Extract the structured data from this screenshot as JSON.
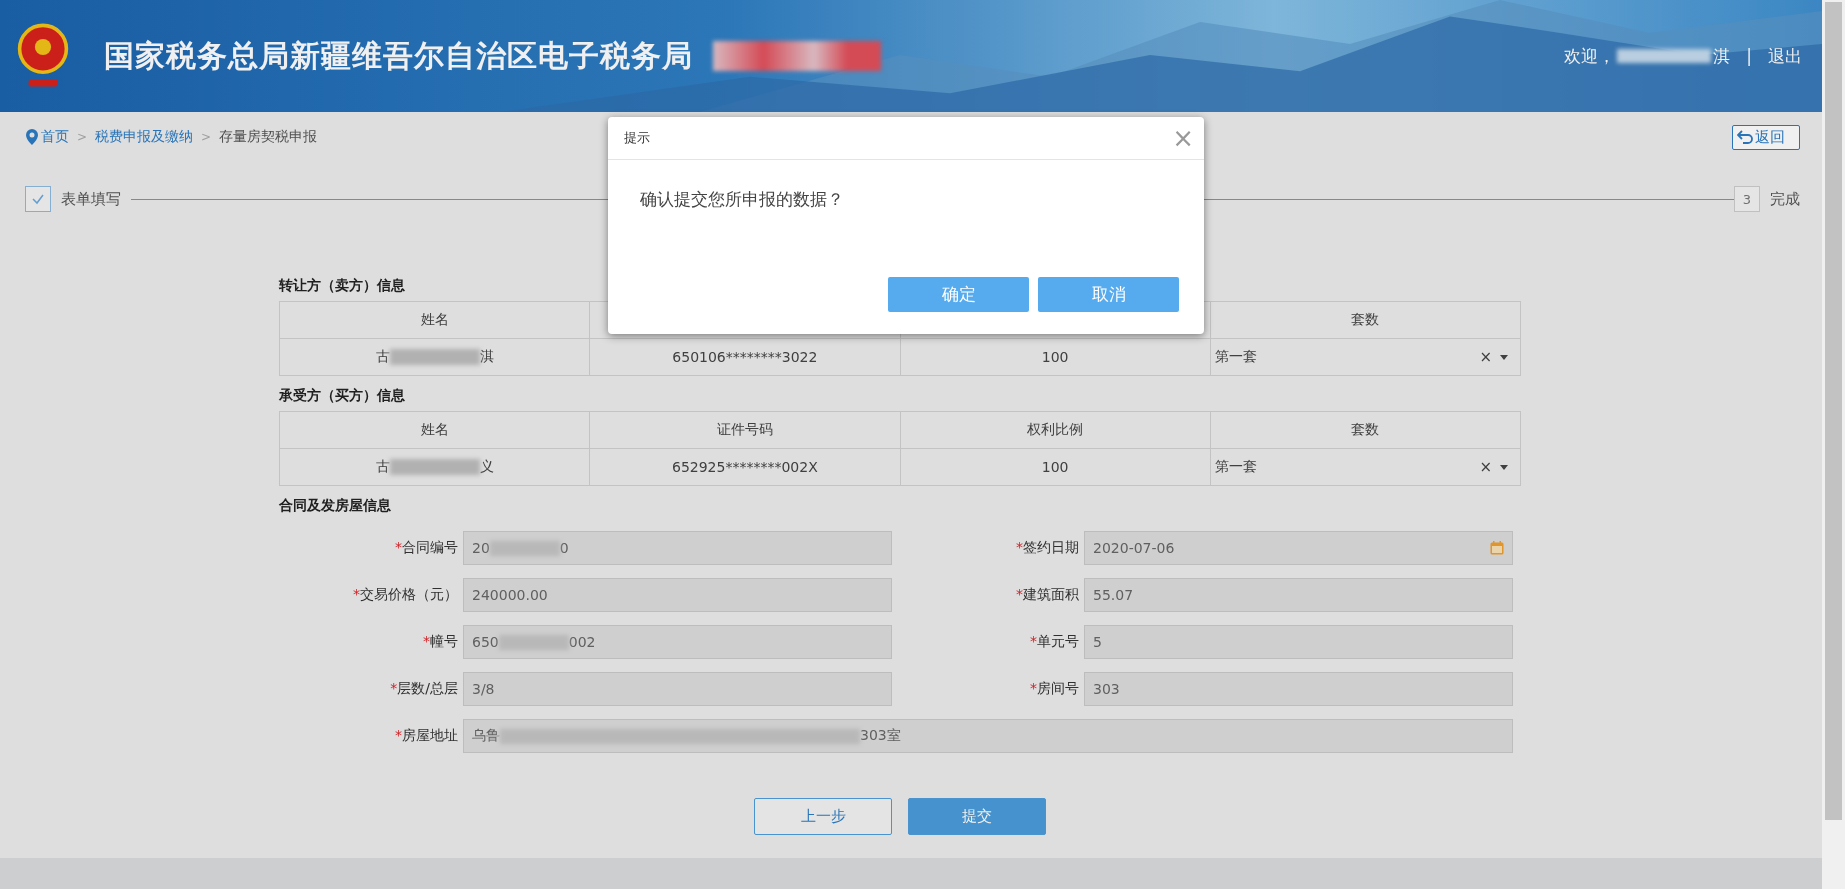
{
  "header": {
    "title": "国家税务总局新疆维吾尔自治区电子税务局",
    "welcome": "欢迎，",
    "user_tail": "淇",
    "separator": "|",
    "logout": "退出"
  },
  "breadcrumb": [
    {
      "label": "首页",
      "kind": "link"
    },
    {
      "label": "税费申报及缴纳",
      "kind": "link"
    },
    {
      "label": "存量房契税申报",
      "kind": "current"
    }
  ],
  "breadcrumb_separator": ">",
  "back_button": "返回",
  "steps": [
    {
      "label": "表单填写",
      "done": true
    },
    {
      "label": "完成",
      "marker": "3",
      "done": false
    }
  ],
  "seller": {
    "title": "转让方（卖方）信息",
    "columns": [
      "姓名",
      "",
      "",
      "套数"
    ],
    "row": {
      "name_start": "古",
      "name_end": "淇",
      "id": "650106********3022",
      "share": "100",
      "set": "第一套"
    }
  },
  "buyer": {
    "title": "承受方（买方）信息",
    "columns": [
      "姓名",
      "证件号码",
      "权利比例",
      "套数"
    ],
    "row": {
      "name_start": "古",
      "name_end": "义",
      "id": "652925********002X",
      "share": "100",
      "set": "第一套"
    }
  },
  "select_clear": "×",
  "contract": {
    "title": "合同及发房屋信息",
    "fields": [
      {
        "label": "合同编号",
        "start": "20",
        "end": "0",
        "kind": "redacted"
      },
      {
        "label": "签约日期",
        "value": "2020-07-06",
        "kind": "date"
      },
      {
        "label": "交易价格（元）",
        "value": "240000.00",
        "kind": "text"
      },
      {
        "label": "建筑面积",
        "value": "55.07",
        "kind": "text"
      },
      {
        "label": "幢号",
        "start": "650",
        "end": "002",
        "kind": "redacted"
      },
      {
        "label": "单元号",
        "value": "5",
        "kind": "text"
      },
      {
        "label": "层数/总层",
        "value": "3/8",
        "kind": "text"
      },
      {
        "label": "房间号",
        "value": "303",
        "kind": "text"
      },
      {
        "label": "房屋地址",
        "start": "乌鲁",
        "end": "303室",
        "kind": "redacted_wide"
      }
    ]
  },
  "required_mark": "*",
  "actions": [
    {
      "label": "上一步",
      "kind": "secondary"
    },
    {
      "label": "提交",
      "kind": "primary"
    }
  ],
  "dialog": {
    "title": "提示",
    "close": "×",
    "message": "确认提交您所申报的数据？",
    "buttons": [
      "确定",
      "取消"
    ]
  }
}
